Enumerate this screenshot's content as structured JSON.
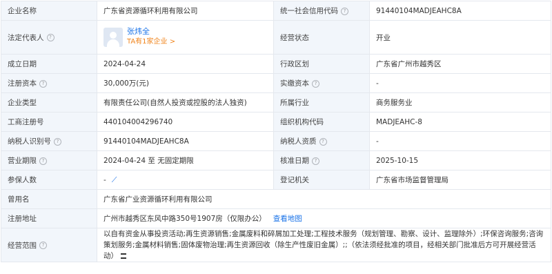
{
  "rows": [
    {
      "l1": "企业名称",
      "v1": "广东省资源循环利用有限公司",
      "l2": "统一社会信用代码",
      "v2": "91440104MADJEAHC8A"
    },
    {
      "l1": "法定代表人",
      "rep_name": "张炜全",
      "rep_link": "TA有1家企业 >",
      "l2": "经营状态",
      "v2": "开业"
    },
    {
      "l1": "成立日期",
      "v1": "2024-04-24",
      "l2": "行政区划",
      "v2": "广东省广州市越秀区"
    },
    {
      "l1": "注册资本",
      "v1": "30,000万(元)",
      "l2": "实缴资本",
      "v2": "-"
    },
    {
      "l1": "企业类型",
      "v1": "有限责任公司(自然人投资或控股的法人独资)",
      "l2": "所属行业",
      "v2": "商务服务业"
    },
    {
      "l1": "工商注册号",
      "v1": "440104004296740",
      "l2": "组织机构代码",
      "v2": "MADJEAHC-8"
    },
    {
      "l1": "纳税人识别号",
      "v1": "91440104MADJEAHC8A",
      "l2": "纳税人资质",
      "v2": "-"
    },
    {
      "l1": "营业期限",
      "v1": "2024-04-24 至 无固定期限",
      "l2": "核准日期",
      "v2": "2025-10-15"
    },
    {
      "l1": "参保人数",
      "v1": "-",
      "trend_icon": "trend-chart-icon",
      "l2": "登记机关",
      "v2": "广东省市场监督管理局"
    }
  ],
  "former_name": {
    "label": "曾用名",
    "value": "广东省广业资源循环利用有限公司"
  },
  "address": {
    "label": "注册地址",
    "value": "广州市越秀区东风中路350号1907房（仅限办公）",
    "map_link": "查看地图"
  },
  "scope": {
    "label": "经营范围",
    "value": "以自有资金从事投资活动;再生资源销售;金属废料和碎屑加工处理;工程技术服务（规划管理、勘察、设计、监理除外）;环保咨询服务;咨询策划服务;金属材料销售;固体废物治理;再生资源回收（除生产性废旧金属）;;（依法须经批准的项目，经相关部门批准后方可开展经营活动）"
  },
  "help_icon": "question-circle-icon",
  "colors": {
    "label_bg": "#f2f6fb",
    "border": "#e4e8ee",
    "link": "#1a73e8",
    "orange": "#f08319"
  }
}
